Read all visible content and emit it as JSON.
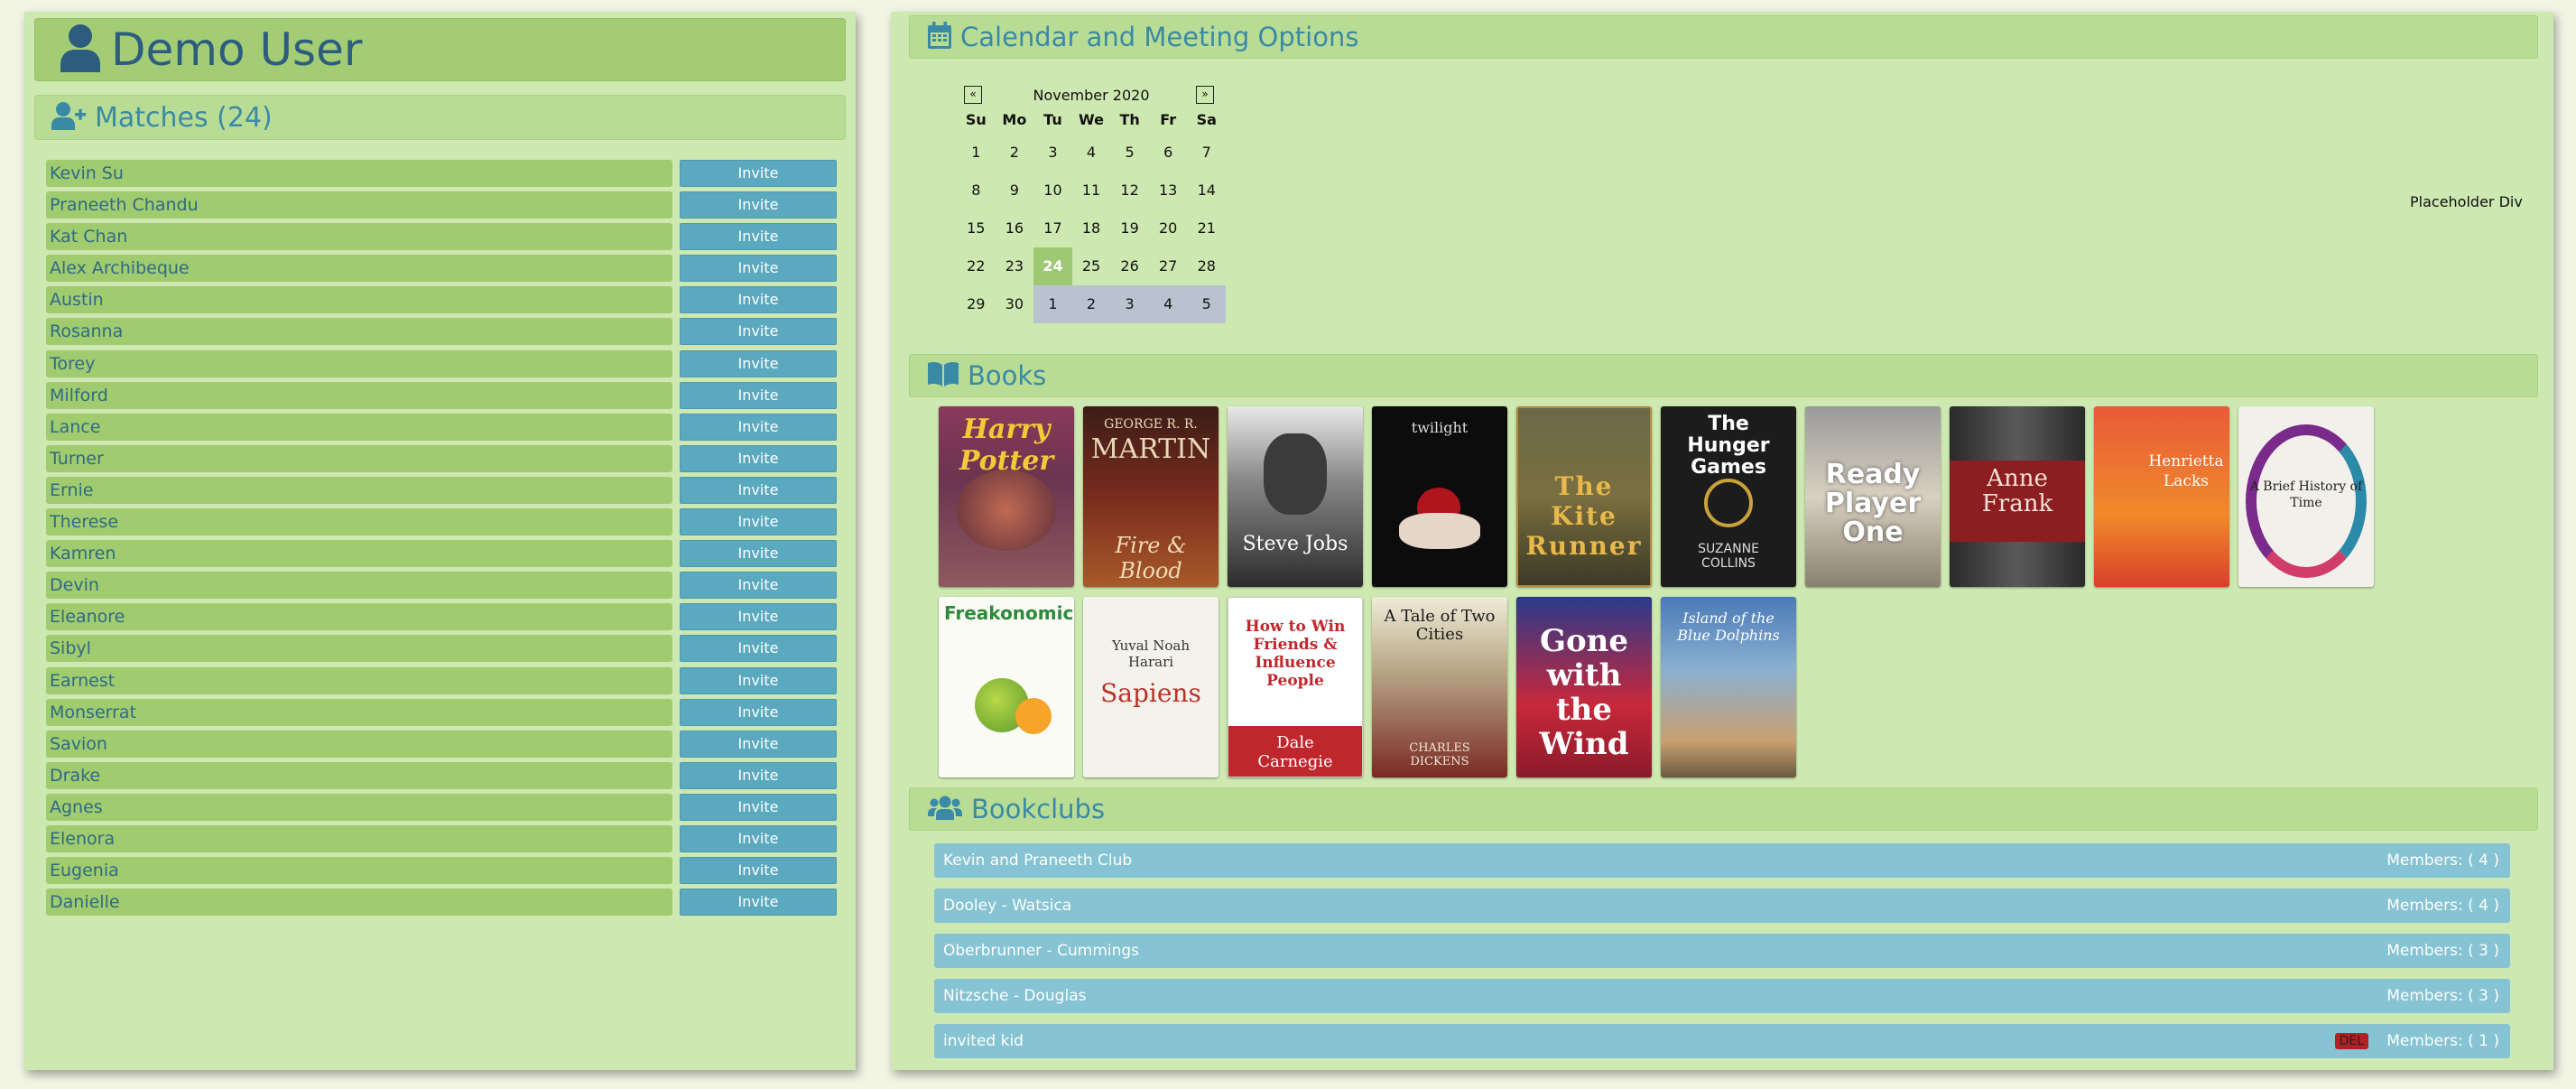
{
  "user": {
    "name": "Demo User",
    "icon": "user-icon"
  },
  "matches": {
    "title": "Matches (24)",
    "icon": "user-plus-icon",
    "invite_label": "Invite",
    "items": [
      "Kevin Su",
      "Praneeth Chandu",
      "Kat Chan",
      "Alex Archibeque",
      "Austin",
      "Rosanna",
      "Torey",
      "Milford",
      "Lance",
      "Turner",
      "Ernie",
      "Therese",
      "Kamren",
      "Devin",
      "Eleanore",
      "Sibyl",
      "Earnest",
      "Monserrat",
      "Savion",
      "Drake",
      "Agnes",
      "Elenora",
      "Eugenia",
      "Danielle"
    ]
  },
  "calendar": {
    "title": "Calendar and Meeting Options",
    "icon": "calendar-icon",
    "month": "November 2020",
    "prev": "«",
    "next": "»",
    "dow": [
      "Su",
      "Mo",
      "Tu",
      "We",
      "Th",
      "Fr",
      "Sa"
    ],
    "weeks": [
      [
        "1",
        "2",
        "3",
        "4",
        "5",
        "6",
        "7"
      ],
      [
        "8",
        "9",
        "10",
        "11",
        "12",
        "13",
        "14"
      ],
      [
        "15",
        "16",
        "17",
        "18",
        "19",
        "20",
        "21"
      ],
      [
        "22",
        "23",
        "24",
        "25",
        "26",
        "27",
        "28"
      ],
      [
        "29",
        "30",
        "1",
        "2",
        "3",
        "4",
        "5"
      ]
    ],
    "today": "24",
    "placeholder": "Placeholder Div"
  },
  "books": {
    "title": "Books",
    "icon": "book-open-icon",
    "covers_row1": [
      "Harry Potter",
      "Fire & Blood",
      "Steve Jobs",
      "twilight",
      "The Kite Runner",
      "The Hunger Games",
      "Ready Player One",
      "Anne Frank",
      "Henrietta Lacks",
      "A Brief History of Time"
    ],
    "covers_row2": [
      "Freakonomics",
      "Sapiens",
      "How to Win Friends & Influence People",
      "A Tale of Two Cities",
      "Gone with the Wind",
      "Island of the Blue Dolphins"
    ]
  },
  "bookclubs": {
    "title": "Bookclubs",
    "icon": "users-icon",
    "del_label": "DEL",
    "items": [
      {
        "name": "Kevin and Praneeth Club",
        "members": "Members: ( 4 )"
      },
      {
        "name": "Dooley - Watsica",
        "members": "Members: ( 4 )"
      },
      {
        "name": "Oberbrunner - Cummings",
        "members": "Members: ( 3 )"
      },
      {
        "name": "Nitzsche - Douglas",
        "members": "Members: ( 3 )"
      },
      {
        "name": "invited kid",
        "members": "Members: ( 1 )"
      }
    ]
  },
  "colors": {
    "panel": "#cde8b0",
    "header_green": "#a3cc74",
    "invite_blue": "#5aa9bf",
    "club_blue": "#86c3d3",
    "title_blue": "#3a8aa6"
  }
}
